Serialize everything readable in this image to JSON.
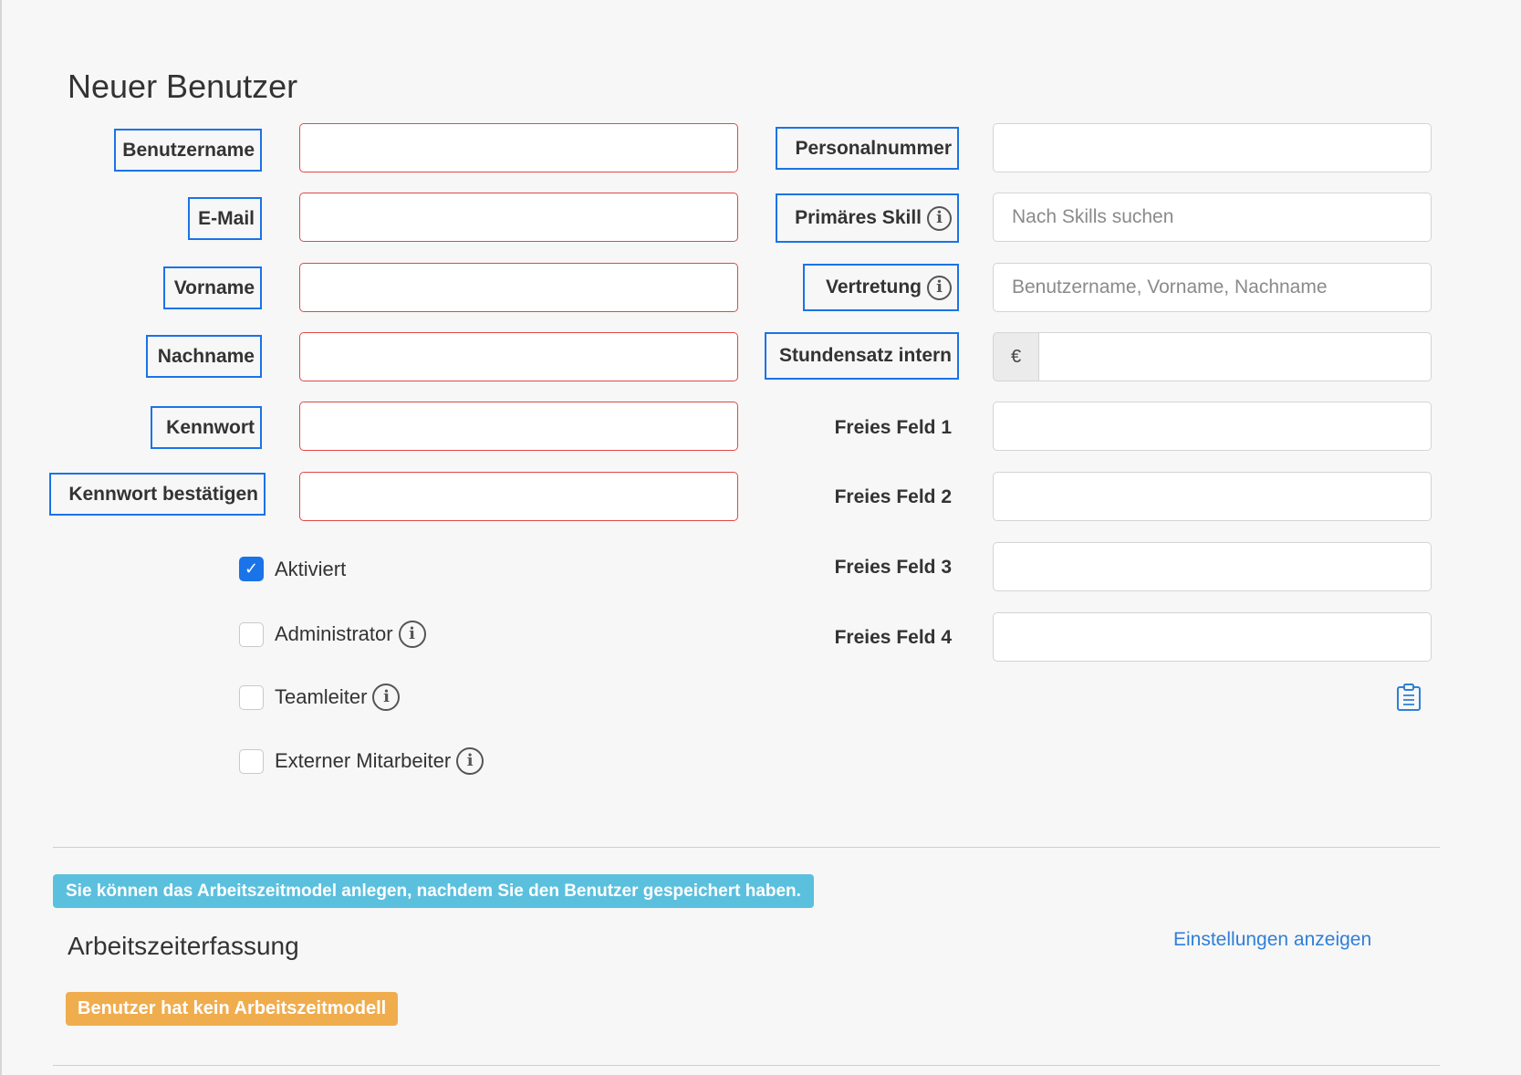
{
  "page": {
    "title": "Neuer Benutzer"
  },
  "left_fields": [
    {
      "label": "Benutzername",
      "value": ""
    },
    {
      "label": "E-Mail",
      "value": ""
    },
    {
      "label": "Vorname",
      "value": ""
    },
    {
      "label": "Nachname",
      "value": ""
    },
    {
      "label": "Kennwort",
      "value": ""
    },
    {
      "label": "Kennwort bestätigen",
      "value": ""
    }
  ],
  "right_fields": {
    "personalnummer": {
      "label": "Personalnummer",
      "value": ""
    },
    "primaeres_skill": {
      "label": "Primäres Skill",
      "placeholder": "Nach Skills suchen"
    },
    "vertretung": {
      "label": "Vertretung",
      "placeholder": "Benutzername, Vorname, Nachname"
    },
    "stundensatz": {
      "label": "Stundensatz intern",
      "currency": "€",
      "value": ""
    },
    "freies_feld_1": {
      "label": "Freies Feld 1",
      "value": ""
    },
    "freies_feld_2": {
      "label": "Freies Feld 2",
      "value": ""
    },
    "freies_feld_3": {
      "label": "Freies Feld 3",
      "value": ""
    },
    "freies_feld_4": {
      "label": "Freies Feld 4",
      "value": ""
    }
  },
  "checkboxes": [
    {
      "label": "Aktiviert",
      "checked": true
    },
    {
      "label": "Administrator",
      "checked": false
    },
    {
      "label": "Teamleiter",
      "checked": false
    },
    {
      "label": "Externer Mitarbeiter",
      "checked": false
    }
  ],
  "info_banner": "Sie können das Arbeitszeitmodel anlegen, nachdem Sie den Benutzer gespeichert haben.",
  "time_tracking": {
    "title": "Arbeitszeiterfassung",
    "settings_link": "Einstellungen anzeigen",
    "no_model_badge": "Benutzer hat kein Arbeitszeitmodell"
  },
  "colors": {
    "accent": "#1a73e8",
    "error_border": "#e04848",
    "info_banner": "#5bc0de",
    "warning_badge": "#f0ad4e",
    "link": "#2f7fd8"
  },
  "icons": {
    "info": "info-icon",
    "clipboard": "clipboard-icon",
    "check": "check-icon"
  }
}
